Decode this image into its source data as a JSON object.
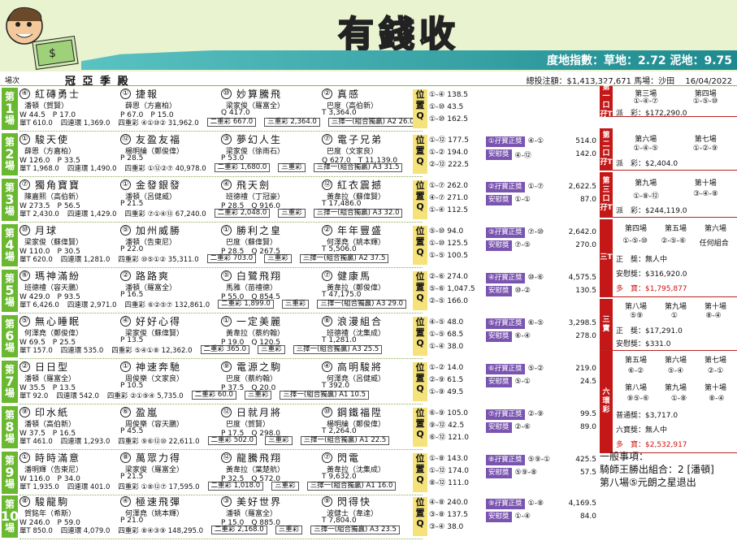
{
  "title": "有錢收",
  "track": {
    "label": "度地指數：草地：2.72 泥地：9.75"
  },
  "info": {
    "race_col": "場次",
    "heading": "冠 亞 季 殿",
    "total": "總投注額：$1,413,327,671",
    "venue": "馬場：沙田",
    "date": "16/04/2022"
  },
  "colors": {
    "green": "#69b82f",
    "red": "#c41818",
    "purple": "#7a55b0",
    "yellow": "#f6e27a"
  },
  "races": [
    {
      "label": "第",
      "num": "1",
      "suffix": "場",
      "horses": [
        {
          "no": "④",
          "name": "紅磚勇士"
        },
        {
          "no": "①",
          "name": "捷報"
        },
        {
          "no": "⑩",
          "name": "妙算騰飛"
        },
        {
          "no": "②",
          "name": "真感"
        }
      ],
      "people": [
        "潘頓（賀賢）",
        "薛恩（方嘉柏）",
        "梁家俊（羅富全）",
        "巴度（高伯新）"
      ],
      "odds": [
        "W 44.5　P 17.0",
        "P 67.0　P 15.0",
        "Q 417.0",
        "T 3,364.0"
      ],
      "extra": [
        "單T 610.0",
        "四連環 1,369.0",
        "四重彩 ④①⑩② 31,962.0",
        "二重彩 667.0",
        "三重彩 2,364.0",
        "三擇一(組合獨贏) A2 26.0"
      ],
      "pos": [
        "①-④ 138.5",
        "①-⑩ 43.5",
        "①-⑩ 162.5"
      ],
      "lucky": []
    },
    {
      "label": "第",
      "num": "2",
      "suffix": "場",
      "horses": [
        {
          "no": "①",
          "name": "駿天使"
        },
        {
          "no": "⑫",
          "name": "友盈友福"
        },
        {
          "no": "③",
          "name": "夢幻人生"
        },
        {
          "no": "⑦",
          "name": "電子兄弟"
        }
      ],
      "people": [
        "薛恩（方嘉柏）",
        "楊明綸（鄭俊偉）",
        "梁家俊（徐雨石）",
        "巴度（文家良）"
      ],
      "odds": [
        "W 126.0　P 33.5",
        "P 28.5",
        "P 53.0",
        "Q 627.0　T 11,139.0"
      ],
      "extra": [
        "單T 1,968.0",
        "四連環 1,490.0",
        "四重彩 ①⑫②⑦ 40,978.0",
        "二重彩 1,680.0",
        "三重彩",
        "三擇一(組合獨贏) A3 31.5"
      ],
      "pos": [
        "①-⑫ 177.5",
        "①-② 194.0",
        "②-⑫ 222.5"
      ],
      "lucky": [
        {
          "tag": "①孖寶正獎",
          "c": "④-①",
          "v": "514.0"
        },
        {
          "tag": "安慰獎",
          "c": "④-⑫",
          "v": "142.0"
        }
      ]
    },
    {
      "label": "第",
      "num": "3",
      "suffix": "場",
      "horses": [
        {
          "no": "⑦",
          "name": "獨角寶寶"
        },
        {
          "no": "①",
          "name": "金發銀發"
        },
        {
          "no": "④",
          "name": "飛天劍"
        },
        {
          "no": "⑫",
          "name": "紅衣震撼"
        }
      ],
      "people": [
        "陳嘉熙（高伯新）",
        "潘頓（呂健威）",
        "班德禮（丁冠豪）",
        "黃韋拉（蘇偉賢）"
      ],
      "odds": [
        "W 273.5　P 56.5",
        "P 21.5",
        "P 28.5　Q 916.0",
        "T 17,486.0"
      ],
      "extra": [
        "單T 2,430.0",
        "四連環 1,429.0",
        "四重彩 ⑦①④⑬ 67,240.0",
        "二重彩 2,048.0",
        "三重彩",
        "三擇一(組合獨贏) A3 32.0"
      ],
      "pos": [
        "①-⑦ 262.0",
        "④-⑦ 271.0",
        "①-④ 112.5"
      ],
      "lucky": [
        {
          "tag": "②孖寶正獎",
          "c": "①-⑦",
          "v": "2,622.5"
        },
        {
          "tag": "安慰獎",
          "c": "①-①",
          "v": "87.0"
        }
      ]
    },
    {
      "label": "第",
      "num": "4",
      "suffix": "場",
      "horses": [
        {
          "no": "⑩",
          "name": "月球"
        },
        {
          "no": "⑤",
          "name": "加州威勝"
        },
        {
          "no": "①",
          "name": "勝利之皇"
        },
        {
          "no": "②",
          "name": "年年豐盛"
        }
      ],
      "people": [
        "梁家俊（蘇偉賢）",
        "潘頓（告東尼）",
        "巴度（蘇偉賢）",
        "何澤堯（姚本輝）"
      ],
      "odds": [
        "W 110.0　P 30.5",
        "P 22.0",
        "P 28.5　Q 267.5",
        "T 5,506.0"
      ],
      "extra": [
        "單T 620.0",
        "四連環 1,281.0",
        "四重彩 ⑩⑤①② 35,311.0",
        "二重彩 703.0",
        "三重彩",
        "三擇一(組合獨贏) A2 37.5"
      ],
      "pos": [
        "⑤-⑩ 94.0",
        "①-⑩ 125.5",
        "①-⑤ 100.5"
      ],
      "lucky": [
        {
          "tag": "③孖寶正獎",
          "c": "⑦-⑩",
          "v": "2,642.0"
        },
        {
          "tag": "安慰獎",
          "c": "⑦-⑤",
          "v": "270.0"
        }
      ]
    },
    {
      "label": "第",
      "num": "5",
      "suffix": "場",
      "horses": [
        {
          "no": "⑥",
          "name": "瑪神滿紛"
        },
        {
          "no": "②",
          "name": "路路爽"
        },
        {
          "no": "⑤",
          "name": "白鷺飛翔"
        },
        {
          "no": "⑦",
          "name": "健康馬"
        }
      ],
      "people": [
        "班德禮（容天鵬）",
        "潘頓（羅富全）",
        "馬雅（苗禮德）",
        "黃韋拉（鄭俊偉）"
      ],
      "odds": [
        "W 429.0　P 93.5",
        "P 16.5",
        "P 55.0　Q 854.5",
        "T 47,175.0"
      ],
      "extra": [
        "單T 6,426.0",
        "四連環 2,971.0",
        "四重彩 ⑥②⑤⑦ 132,861.0",
        "二重彩 1,899.0",
        "三重彩",
        "三擇一(組合獨贏) A3 29.0"
      ],
      "pos": [
        "②-⑥ 274.0",
        "⑤-⑥ 1,047.5",
        "②-⑤ 166.0"
      ],
      "lucky": [
        {
          "tag": "④孖寶正獎",
          "c": "⑩-⑥",
          "v": "4,575.5"
        },
        {
          "tag": "安慰獎",
          "c": "⑩-②",
          "v": "130.5"
        }
      ]
    },
    {
      "label": "第",
      "num": "6",
      "suffix": "場",
      "horses": [
        {
          "no": "⑤",
          "name": "無心睡眠"
        },
        {
          "no": "④",
          "name": "好好心得"
        },
        {
          "no": "①",
          "name": "一定美麗"
        },
        {
          "no": "⑧",
          "name": "浪漫組合"
        }
      ],
      "people": [
        "何澤堯（鄭俊偉）",
        "梁家俊（蘇偉賢）",
        "黃韋拉（蔡約翰）",
        "班德禮（沈集成）"
      ],
      "odds": [
        "W 69.5　P 25.5",
        "P 13.5",
        "P 19.0　Q 120.5",
        "T 1,281.0"
      ],
      "extra": [
        "單T 157.0",
        "四連環 535.0",
        "四重彩 ⑤④①⑧ 12,362.0",
        "二重彩 365.0",
        "三重彩",
        "三擇一(組合獨贏) A3 25.5"
      ],
      "pos": [
        "④-⑤ 48.0",
        "①-⑤ 68.5",
        "①-④ 38.0"
      ],
      "lucky": [
        {
          "tag": "⑤孖寶正獎",
          "c": "⑥-⑤",
          "v": "3,298.5"
        },
        {
          "tag": "安慰獎",
          "c": "⑥-④",
          "v": "278.0"
        }
      ]
    },
    {
      "label": "第",
      "num": "7",
      "suffix": "場",
      "horses": [
        {
          "no": "②",
          "name": "日日型"
        },
        {
          "no": "①",
          "name": "神速奔馳"
        },
        {
          "no": "⑨",
          "name": "電源之駒"
        },
        {
          "no": "④",
          "name": "高明駿將"
        }
      ],
      "people": [
        "潘頓（羅富全）",
        "周俊樂（文家良）",
        "巴度（蔡約翰）",
        "何澤堯（呂健威）"
      ],
      "odds": [
        "W 35.5　P 13.5",
        "P 10.5",
        "P 37.5　Q 20.0",
        "T 392.0"
      ],
      "extra": [
        "單T 92.0",
        "四連環 542.0",
        "四重彩 ②①⑨④ 5,735.0",
        "二重彩 60.0",
        "三重彩",
        "三擇一(組合獨贏) A1 10.5"
      ],
      "pos": [
        "①-② 14.0",
        "②-⑨ 61.5",
        "①-⑨ 49.5"
      ],
      "lucky": [
        {
          "tag": "⑥孖寶正獎",
          "c": "⑤-②",
          "v": "219.0"
        },
        {
          "tag": "安慰獎",
          "c": "⑤-①",
          "v": "24.5"
        }
      ]
    },
    {
      "label": "第",
      "num": "8",
      "suffix": "場",
      "horses": [
        {
          "no": "⑨",
          "name": "印水紙"
        },
        {
          "no": "⑥",
          "name": "盈嵐"
        },
        {
          "no": "⑫",
          "name": "日就月將"
        },
        {
          "no": "⑩",
          "name": "鋼鐵福陞"
        }
      ],
      "people": [
        "潘頓（高伯新）",
        "周俊樂（容天鵬）",
        "巴度（賀賢）",
        "楊明綸（鄭俊偉）"
      ],
      "odds": [
        "W 37.5　P 16.5",
        "P 45.5",
        "P 17.5　Q 298.0",
        "T 2,264.0"
      ],
      "extra": [
        "單T 461.0",
        "四連環 1,293.0",
        "四重彩 ⑨⑥⑫⑩ 22,611.0",
        "二重彩 502.0",
        "三重彩",
        "三擇一(組合獨贏) A1 22.5"
      ],
      "pos": [
        "⑥-⑨ 105.0",
        "⑨-⑫ 42.5",
        "⑥-⑫ 121.0"
      ],
      "lucky": [
        {
          "tag": "⑦孖寶正獎",
          "c": "②-⑨",
          "v": "99.5"
        },
        {
          "tag": "安慰獎",
          "c": "②-⑥",
          "v": "89.0"
        }
      ]
    },
    {
      "label": "第",
      "num": "9",
      "suffix": "場",
      "horses": [
        {
          "no": "①",
          "name": "時時滿意"
        },
        {
          "no": "⑧",
          "name": "萬眾力得"
        },
        {
          "no": "⑫",
          "name": "龍騰飛翔"
        },
        {
          "no": "⑦",
          "name": "閃電"
        }
      ],
      "people": [
        "潘明輝（告東尼）",
        "梁家俊（羅富全）",
        "黃韋拉（葉楚航）",
        "黃韋拉（沈集成）"
      ],
      "odds": [
        "W 116.0　P 34.0",
        "P 21.5",
        "P 32.5　Q 572.0",
        "T 9,632.0"
      ],
      "extra": [
        "單T 1,935.0",
        "四連環 401.0",
        "四重彩 ①⑧⑫⑦ 17,595.0",
        "二重彩 1,018.0",
        "三重彩",
        "三擇一(組合獨贏) A1 16.0"
      ],
      "pos": [
        "①-⑧ 143.0",
        "①-⑫ 174.0",
        "⑧-⑫ 111.0"
      ],
      "lucky": [
        {
          "tag": "⑧孖寶正獎",
          "c": "⑤⑨-①",
          "v": "425.5"
        },
        {
          "tag": "安慰獎",
          "c": "⑤⑨-⑧",
          "v": "57.5"
        }
      ]
    },
    {
      "label": "第",
      "num": "10",
      "suffix": "場",
      "horses": [
        {
          "no": "⑧",
          "name": "駿龍駒"
        },
        {
          "no": "④",
          "name": "極速飛彈"
        },
        {
          "no": "③",
          "name": "美好世界"
        },
        {
          "no": "⑨",
          "name": "閃得快"
        }
      ],
      "people": [
        "賀銘年（希斯）",
        "何澤堯（姚本輝）",
        "潘頓（羅富全）",
        "波健士（韋達）"
      ],
      "odds": [
        "W 246.0　P 59.0",
        "P 21.0",
        "P 15.0　Q 885.0",
        "T 7,804.0"
      ],
      "extra": [
        "單T 850.0",
        "四連環 4,079.0",
        "四重彩 ⑧④③⑨ 148,295.0",
        "二重彩 2,168.0",
        "三重彩",
        "三擇一(組合獨贏) A3 23.5"
      ],
      "pos": [
        "④-⑧ 240.0",
        "③-⑧ 137.5",
        "③-④ 38.0"
      ],
      "lucky": [
        {
          "tag": "⑨孖寶正獎",
          "c": "①-⑧",
          "v": "4,169.5"
        },
        {
          "tag": "安慰獎",
          "c": "①-④",
          "v": "84.0"
        }
      ]
    }
  ],
  "right": {
    "dbl1": {
      "bar": "第一口孖T",
      "h": [
        "第三場",
        "第四場"
      ],
      "v": [
        "①-④-⑦",
        "①-⑤-⑩"
      ],
      "pay": "派　彩：$172,290.0"
    },
    "dbl2": {
      "bar": "第二口孖T",
      "h": [
        "第六場",
        "第七場"
      ],
      "v": [
        "①-④-⑤",
        "①-②-⑨"
      ],
      "pay": "派　彩：$2,404.0"
    },
    "dbl3": {
      "bar": "第三口孖T",
      "h": [
        "第九場",
        "第十場"
      ],
      "v": [
        "①-⑧-⑫",
        "③-④-⑧"
      ],
      "pay": "派　彩：$244,119.0"
    },
    "triple": {
      "bar": "三T",
      "h": [
        "第四場",
        "第五場",
        "第六場"
      ],
      "v": [
        "①-⑤-⑩",
        "②-⑤-⑥",
        "任何組合"
      ],
      "p1": "正　獎：無人中",
      "p2": "安慰獎：$316,920.0",
      "p3": "多　寶：$1,795,877"
    },
    "treble": {
      "bar": "三寶",
      "h": [
        "第八場",
        "第九場",
        "第十場"
      ],
      "v": [
        "⑤⑨",
        "①",
        "⑧-④"
      ],
      "p1": "正　獎：$17,291.0",
      "p2": "安慰獎：$331.0"
    },
    "six": {
      "bar": "六環彩",
      "h1": [
        "第五場",
        "第六場",
        "第七場"
      ],
      "v1": [
        "⑥-②",
        "⑤-④",
        "②-①"
      ],
      "h2": [
        "第八場",
        "第九場",
        "第十場"
      ],
      "v2": [
        "⑨⑤-⑥",
        "①-⑧",
        "⑧-④"
      ],
      "p1": "普通獎：$3,717.0",
      "p2": "六寶獎：無人中",
      "p3": "多　寶：$2,532,917"
    },
    "note": {
      "h": "一般事項：",
      "l1": "騎師王勝出組合：2 [潘頓]",
      "l2": "第八場⑤元朗之星退出"
    }
  }
}
